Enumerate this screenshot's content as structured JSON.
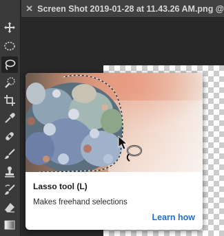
{
  "tab": {
    "close_icon": "close-icon",
    "title": "Screen Shot 2019-01-28 at 11.43.26 AM.png @"
  },
  "toolbar": {
    "tools": [
      {
        "name": "move-tool",
        "icon": "move-icon"
      },
      {
        "name": "marquee-tool",
        "icon": "ellipse-marquee-icon"
      },
      {
        "name": "lasso-tool",
        "icon": "lasso-icon",
        "active": true
      },
      {
        "name": "quick-selection-tool",
        "icon": "quick-selection-icon"
      },
      {
        "name": "crop-tool",
        "icon": "crop-icon"
      },
      {
        "name": "eyedropper-tool",
        "icon": "eyedropper-icon"
      },
      {
        "name": "healing-brush-tool",
        "icon": "bandage-icon"
      },
      {
        "name": "brush-tool",
        "icon": "brush-icon"
      },
      {
        "name": "clone-stamp-tool",
        "icon": "stamp-icon"
      },
      {
        "name": "history-brush-tool",
        "icon": "history-brush-icon"
      },
      {
        "name": "eraser-tool",
        "icon": "eraser-icon"
      },
      {
        "name": "gradient-tool",
        "icon": "gradient-icon"
      }
    ]
  },
  "tooltip": {
    "title": "Lasso tool (L)",
    "description": "Makes freehand selections",
    "link_label": "Learn how"
  },
  "colors": {
    "toolbar_bg": "#3a3a3a",
    "tab_bg": "#424242",
    "link_blue": "#1d6fd6"
  }
}
